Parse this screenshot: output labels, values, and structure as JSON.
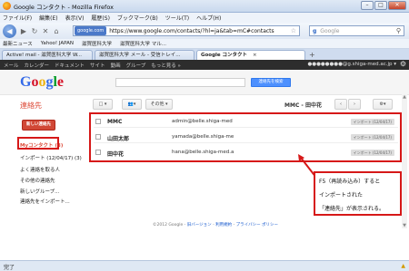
{
  "window": {
    "title": "Google コンタクト - Mozilla Firefox",
    "buttons": {
      "minimize": "–",
      "maximize": "□",
      "close": "✕"
    }
  },
  "menubar": [
    "ファイル(F)",
    "編集(E)",
    "表示(V)",
    "履歴(S)",
    "ブックマーク(B)",
    "ツール(T)",
    "ヘルプ(H)"
  ],
  "navbar": {
    "site_badge": "google.com",
    "url": "https://www.google.com/contacts/?hl=ja&tab=mC#contacts",
    "search_engine": "Google",
    "search_placeholder": "Google"
  },
  "bookmarks": [
    "最新ニュース",
    "Yahoo! JAPAN",
    "滋賀医科大学",
    "滋賀医科大学 マル..."
  ],
  "tabs": [
    {
      "label": "Active! mail - 滋賀医科大学 W..."
    },
    {
      "label": "滋賀医科大学 メール - 受信トレイ..."
    },
    {
      "label": "Google コンタクト"
    }
  ],
  "gbar": {
    "items": [
      "メール",
      "カレンダー",
      "ドキュメント",
      "サイト",
      "動画",
      "グループ",
      "もっと見る »"
    ],
    "account": "●●●●●●●●@g.shiga-med.ac.jp ▾"
  },
  "header": {
    "logo_letters": [
      "G",
      "o",
      "o",
      "g",
      "l",
      "e"
    ],
    "search_button": "連絡先を検索"
  },
  "app": {
    "title": "連絡先",
    "toolbar": {
      "select": "□ ▾",
      "group": "👥▾",
      "more": "その他 ▾",
      "contact_name": "MMC - 田中花",
      "prev": "‹",
      "next": "›",
      "settings": "⚙▾"
    }
  },
  "sidebar": {
    "new_contact": "新しい連絡先",
    "items": [
      {
        "label": "Myコンタクト (3)",
        "selected": true
      },
      {
        "label": "インポート (12/04/17) (3)"
      },
      {
        "label": "よく連絡を取る人"
      },
      {
        "label": "その他の連絡先"
      },
      {
        "label": "新しいグループ..."
      },
      {
        "label": "連絡先をインポート..."
      }
    ]
  },
  "contacts": [
    {
      "name": "MMC",
      "email": "admin@belle.shiga-med",
      "tag": "インポート (12/04/17)"
    },
    {
      "name": "山田太郎",
      "email": "yamada@belle.shiga-me",
      "tag": "インポート (12/04/17)"
    },
    {
      "name": "田中花",
      "email": "hana@belle.shiga-med.a",
      "tag": "インポート (12/04/17)"
    }
  ],
  "callout": {
    "lines": [
      "F5（再読み込み）すると",
      "インポートされた",
      "「連絡先」が表示される。"
    ],
    "border_color": "#d61818"
  },
  "footer": {
    "copyright": "©2012 Google - ",
    "links": [
      "旧バージョン",
      "利用規約",
      "プライバシー ポリシー"
    ],
    "separator": " - "
  },
  "statusbar": {
    "text": "完了"
  }
}
